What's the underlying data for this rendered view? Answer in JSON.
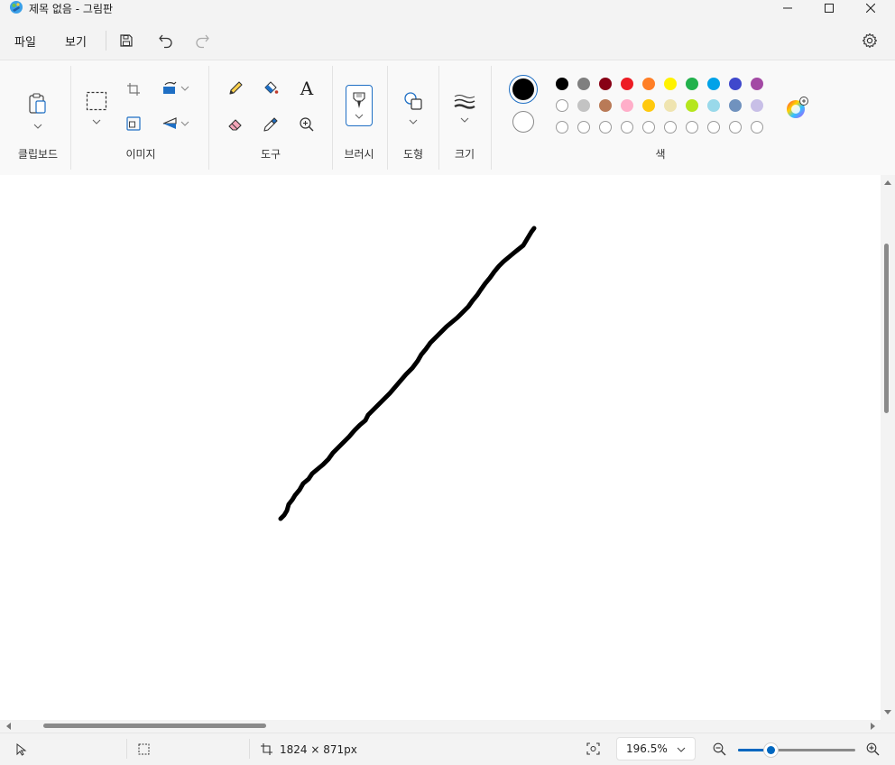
{
  "window": {
    "title": "제목 없음 - 그림판",
    "minimize_glyph": "—",
    "maximize_glyph": "☐",
    "close_glyph": "✕"
  },
  "menu": {
    "file": "파일",
    "view": "보기",
    "save_icon": "save-icon",
    "undo_icon": "undo-icon",
    "redo_icon": "redo-icon",
    "settings_icon": "gear-icon"
  },
  "ribbon": {
    "groups": {
      "clipboard": "클립보드",
      "image": "이미지",
      "tools": "도구",
      "brush": "브러시",
      "shapes": "도형",
      "size": "크기",
      "colors": "색"
    },
    "text_tool_glyph": "A",
    "active_tool": "brush"
  },
  "colors": {
    "primary": "#000000",
    "secondary": "#ffffff",
    "row1": [
      "#000000",
      "#7f7f7f",
      "#880015",
      "#ed1c24",
      "#ff7f27",
      "#fff200",
      "#22b14c",
      "#00a2e8",
      "#3f48cc",
      "#a349a4"
    ],
    "row2": [
      "#ffffff",
      "#c3c3c3",
      "#b97a57",
      "#ffaec9",
      "#ffc90e",
      "#efe4b0",
      "#b5e61d",
      "#99d9ea",
      "#7092be",
      "#c8bfe7"
    ],
    "row3_empty_count": 10,
    "accent": "#0067c0"
  },
  "canvas": {
    "stroke_color": "#000000"
  },
  "status": {
    "canvas_size": "1824 × 871px",
    "zoom": "196.5%",
    "zoom_level_fraction": 0.28
  }
}
